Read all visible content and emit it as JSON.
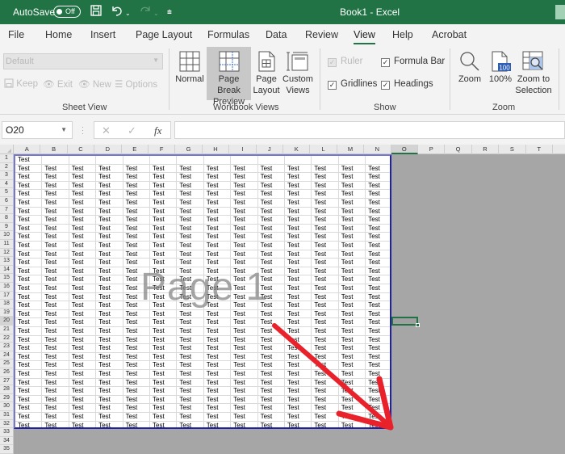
{
  "titlebar": {
    "autosave_label": "AutoSave",
    "autosave_state": "Off",
    "document_title": "Book1  -  Excel",
    "qat_icons": [
      "save-icon",
      "undo-icon",
      "redo-icon",
      "customize-qat-icon"
    ]
  },
  "ribbon_tabs": [
    {
      "label": "File",
      "active": false
    },
    {
      "label": "Home",
      "active": false
    },
    {
      "label": "Insert",
      "active": false
    },
    {
      "label": "Page Layout",
      "active": false
    },
    {
      "label": "Formulas",
      "active": false
    },
    {
      "label": "Data",
      "active": false
    },
    {
      "label": "Review",
      "active": false
    },
    {
      "label": "View",
      "active": true
    },
    {
      "label": "Help",
      "active": false
    },
    {
      "label": "Acrobat",
      "active": false
    }
  ],
  "ribbon": {
    "sheet_view": {
      "group_label": "Sheet View",
      "dropdown_value": "Default",
      "buttons": [
        "Keep",
        "Exit",
        "New",
        "Options"
      ]
    },
    "workbook_views": {
      "group_label": "Workbook Views",
      "buttons": [
        {
          "line1": "Normal",
          "line2": "",
          "active": false
        },
        {
          "line1": "Page Break",
          "line2": "Preview",
          "active": true
        },
        {
          "line1": "Page",
          "line2": "Layout",
          "active": false
        },
        {
          "line1": "Custom",
          "line2": "Views",
          "active": false
        }
      ]
    },
    "show": {
      "group_label": "Show",
      "checkboxes": [
        {
          "label": "Ruler",
          "checked": true,
          "disabled": true
        },
        {
          "label": "Formula Bar",
          "checked": true,
          "disabled": false
        },
        {
          "label": "Gridlines",
          "checked": true,
          "disabled": false
        },
        {
          "label": "Headings",
          "checked": true,
          "disabled": false
        }
      ]
    },
    "zoom": {
      "group_label": "Zoom",
      "buttons": [
        {
          "line1": "Zoom",
          "line2": ""
        },
        {
          "line1": "100%",
          "line2": ""
        },
        {
          "line1": "Zoom to",
          "line2": "Selection"
        }
      ],
      "icon_100_text": "100"
    }
  },
  "formula_bar": {
    "name_box": "O20",
    "cancel_glyph": "✕",
    "enter_glyph": "✓",
    "fx_label": "fx",
    "formula_value": ""
  },
  "sheet": {
    "columns": [
      "A",
      "B",
      "C",
      "D",
      "E",
      "F",
      "G",
      "H",
      "I",
      "J",
      "K",
      "L",
      "M",
      "N",
      "O",
      "P",
      "Q",
      "R",
      "S",
      "T"
    ],
    "rows": [
      "1",
      "2",
      "3",
      "4",
      "5",
      "6",
      "7",
      "8",
      "9",
      "10",
      "11",
      "12",
      "13",
      "14",
      "15",
      "16",
      "17",
      "18",
      "19",
      "20",
      "21",
      "22",
      "23",
      "24",
      "25",
      "26",
      "27",
      "28",
      "29",
      "30",
      "31",
      "32",
      "33",
      "34",
      "35"
    ],
    "selected_column": "O",
    "selected_row": "20",
    "cell_text": "Test",
    "row1_filled_columns": 1,
    "filled_rows": 32,
    "filled_columns": 14,
    "page_watermark": "Page 1"
  },
  "annotation": {
    "arrow_color": "#e8212b"
  }
}
